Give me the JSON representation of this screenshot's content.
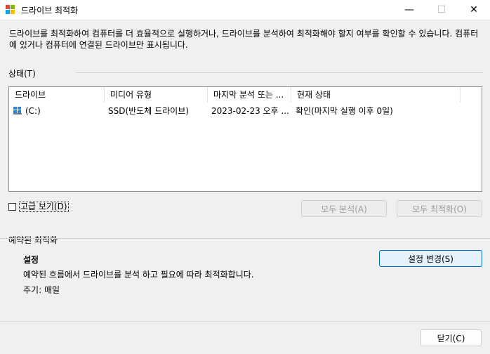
{
  "window": {
    "title": "드라이브 최적화",
    "minimize_glyph": "—",
    "maximize_glyph": "☐",
    "close_glyph": "✕"
  },
  "description": "드라이브를 최적화하여 컴퓨터를 더 효율적으로 실행하거나, 드라이브를 분석하여 최적화해야 할지 여부를 확인할 수 있습니다. 컴퓨터에 있거나 컴퓨터에 연결된 드라이브만 표시됩니다.",
  "status": {
    "label": "상태(T)",
    "columns": [
      "드라이브",
      "미디어 유형",
      "마지막 분석 또는 ...",
      "현재 상태"
    ],
    "rows": [
      {
        "drive": "(C:)",
        "media_type": "SSD(반도체 드라이브)",
        "last_run": "2023-02-23 오후 ...",
        "current_status": "확인(마지막 실행 이후 0일)"
      }
    ]
  },
  "advanced_view_label": "고급 보기(D)",
  "advanced_view_checked": false,
  "buttons": {
    "analyze_all": "모두 분석(A)",
    "optimize_all": "모두 최적화(O)",
    "change_settings": "설정 변경(S)",
    "close": "닫기(C)"
  },
  "scheduled": {
    "title": "예약된 최적화",
    "heading": "설정",
    "text": "예약된 흐름에서 드라이브를 분석 하고 필요에 따라 최적화합니다.",
    "frequency": "주기: 매일"
  },
  "colors": {
    "accent": "#0067c0",
    "primary_button_bg": "#e5f1fb",
    "window_bg": "#f0f0f0"
  },
  "icons": {
    "app": "defrag-app-icon",
    "drive": "windows-drive-icon"
  }
}
